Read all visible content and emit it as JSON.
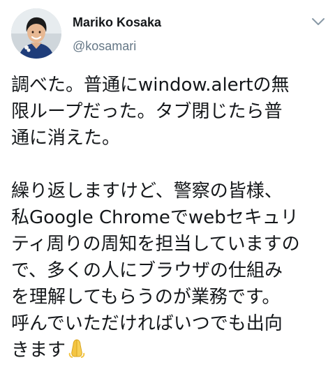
{
  "author": {
    "display_name": "Mariko Kosaka",
    "handle": "@kosamari",
    "avatar_icon": "profile-photo"
  },
  "menu": {
    "icon": "chevron-down-icon"
  },
  "tweet": {
    "paragraph_1": [
      "調べた。普通にwindow.alertの無",
      "限ループだった。タブ閉じたら普",
      "通に消えた。"
    ],
    "paragraph_2": [
      "繰り返しますけど、警察の皆様、",
      "私Google Chromeでwebセキュリ",
      "ティ周りの周知を担当していますの",
      "で、多くの人にブラウザの仕組み",
      "を理解してもらうのが業務です。",
      "呼んでいただければいつでも出向",
      "きます"
    ],
    "trailing_emoji": "folded-hands-emoji"
  },
  "colors": {
    "text": "#14171a",
    "secondary": "#657786",
    "emoji": "#f4c542"
  }
}
